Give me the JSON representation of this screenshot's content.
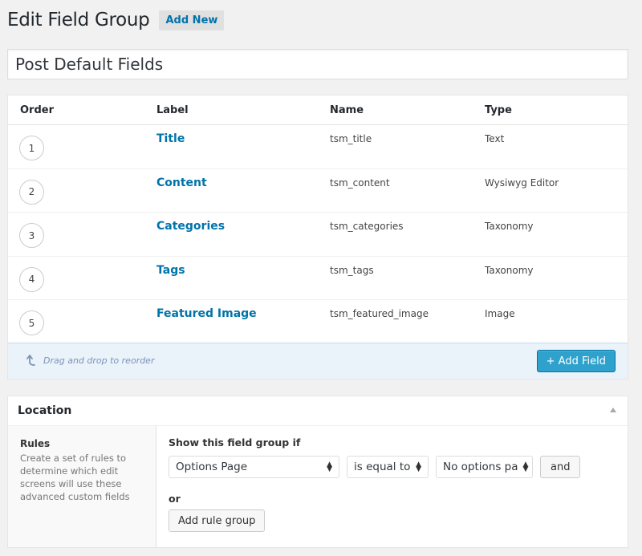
{
  "header": {
    "title": "Edit Field Group",
    "add_new_label": "Add New"
  },
  "group_title": "Post Default Fields",
  "fields_table": {
    "columns": [
      "Order",
      "Label",
      "Name",
      "Type"
    ],
    "rows": [
      {
        "order": "1",
        "label": "Title",
        "name": "tsm_title",
        "type": "Text"
      },
      {
        "order": "2",
        "label": "Content",
        "name": "tsm_content",
        "type": "Wysiwyg Editor"
      },
      {
        "order": "3",
        "label": "Categories",
        "name": "tsm_categories",
        "type": "Taxonomy"
      },
      {
        "order": "4",
        "label": "Tags",
        "name": "tsm_tags",
        "type": "Taxonomy"
      },
      {
        "order": "5",
        "label": "Featured Image",
        "name": "tsm_featured_image",
        "type": "Image"
      }
    ],
    "drag_hint": "Drag and drop to reorder",
    "add_field_label": "+ Add Field"
  },
  "location": {
    "title": "Location",
    "rules_title": "Rules",
    "rules_desc": "Create a set of rules to determine which edit screens will use these advanced custom fields",
    "show_if_label": "Show this field group if",
    "rule": {
      "param": "Options Page",
      "operator": "is equal to",
      "value": "No options pa"
    },
    "and_label": "and",
    "or_label": "or",
    "add_rule_group_label": "Add rule group"
  },
  "colors": {
    "accent": "#0073aa",
    "button_primary": "#2ea2cc",
    "footer_bg": "#eaf2fa"
  }
}
